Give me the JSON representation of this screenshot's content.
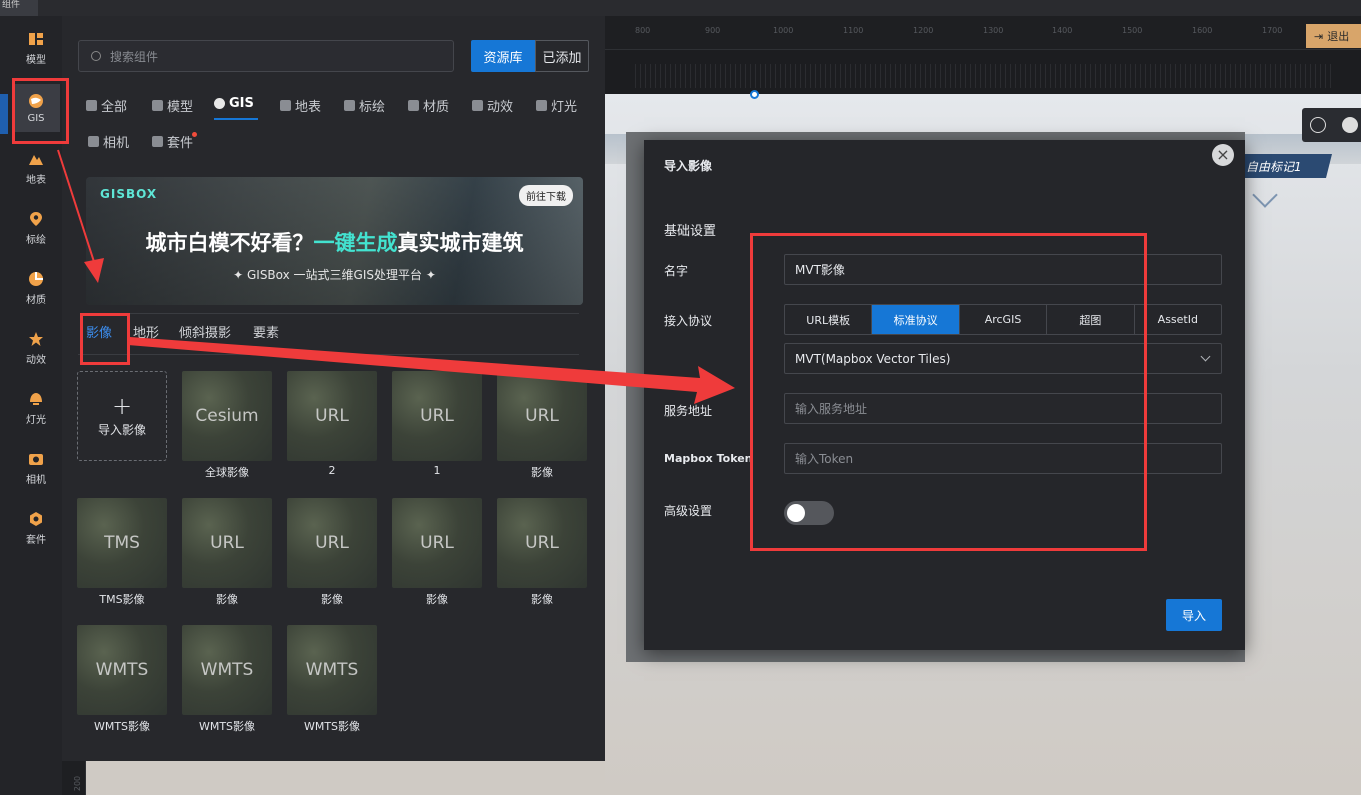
{
  "top": {
    "tab_label": "组件"
  },
  "rail": {
    "items": [
      {
        "label": "模型",
        "icon": "model-icon"
      },
      {
        "label": "GIS",
        "icon": "globe-icon"
      },
      {
        "label": "地表",
        "icon": "terrain-icon"
      },
      {
        "label": "标绘",
        "icon": "pin-icon"
      },
      {
        "label": "材质",
        "icon": "material-icon"
      },
      {
        "label": "动效",
        "icon": "effect-icon"
      },
      {
        "label": "灯光",
        "icon": "light-icon"
      },
      {
        "label": "相机",
        "icon": "camera-icon"
      },
      {
        "label": "套件",
        "icon": "kit-icon"
      }
    ]
  },
  "panel": {
    "search_placeholder": "搜索组件",
    "lib_button": "资源库",
    "added_button": "已添加",
    "categories": [
      "全部",
      "模型",
      "GIS",
      "地表",
      "标绘",
      "材质",
      "动效",
      "灯光",
      "相机",
      "套件"
    ],
    "active_category": "GIS",
    "banner": {
      "logo": "GISBOX",
      "download": "前往下载",
      "headline_pre": "城市白模不好看？",
      "headline_hl": "一键生成",
      "headline_post": "真实城市建筑",
      "sub": "✦  GISBox  一站式三维GIS处理平台  ✦"
    },
    "subtabs": [
      "影像",
      "地形",
      "倾斜摄影",
      "要素"
    ],
    "add_card_label": "导入影像",
    "tiles": [
      {
        "thumb": "Cesium",
        "caption": "全球影像"
      },
      {
        "thumb": "URL",
        "caption": "2"
      },
      {
        "thumb": "URL",
        "caption": "1"
      },
      {
        "thumb": "URL",
        "caption": "影像"
      },
      {
        "thumb": "TMS",
        "caption": "TMS影像"
      },
      {
        "thumb": "URL",
        "caption": "影像"
      },
      {
        "thumb": "URL",
        "caption": "影像"
      },
      {
        "thumb": "URL",
        "caption": "影像"
      },
      {
        "thumb": "URL",
        "caption": "影像"
      },
      {
        "thumb": "WMTS",
        "caption": "WMTS影像"
      },
      {
        "thumb": "WMTS",
        "caption": "WMTS影像"
      },
      {
        "thumb": "WMTS",
        "caption": "WMTS影像"
      }
    ]
  },
  "viewport": {
    "ruler_ticks": [
      "800",
      "900",
      "1000",
      "1100",
      "1200",
      "1300",
      "1400",
      "1500",
      "1600",
      "1700"
    ],
    "exit_label": "退出",
    "marker_label": "自由标记1",
    "vert_ruler_label": "200"
  },
  "dialog": {
    "title": "导入影像",
    "section": "基础设置",
    "name_label": "名字",
    "name_value": "MVT影像",
    "protocol_label": "接入协议",
    "protocols": [
      "URL模板",
      "标准协议",
      "ArcGIS",
      "超图",
      "AssetId"
    ],
    "active_protocol": "标准协议",
    "format_value": "MVT(Mapbox Vector Tiles)",
    "url_label": "服务地址",
    "url_placeholder": "输入服务地址",
    "token_label": "Mapbox Token",
    "token_placeholder": "输入Token",
    "advanced_label": "高级设置",
    "advanced_on": false,
    "import_button": "导入"
  },
  "colors": {
    "accent": "#1677d6",
    "annotation": "#ef3b3b",
    "banner_highlight": "#43e3d0"
  }
}
